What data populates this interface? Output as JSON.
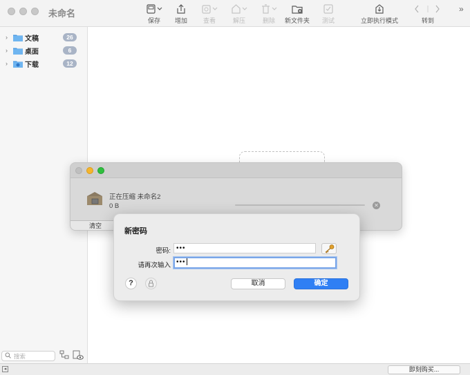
{
  "window": {
    "title": "未命名"
  },
  "toolbar": {
    "items": [
      {
        "label": "保存",
        "icon": "save-archive-icon",
        "enabled": true
      },
      {
        "label": "增加",
        "icon": "add-upload-icon",
        "enabled": true
      },
      {
        "label": "查看",
        "icon": "view-eye-icon",
        "enabled": false
      },
      {
        "label": "解压",
        "icon": "extract-icon",
        "enabled": false
      },
      {
        "label": "删除",
        "icon": "trash-icon",
        "enabled": false
      },
      {
        "label": "新文件夹",
        "icon": "new-folder-icon",
        "enabled": true
      },
      {
        "label": "测试",
        "icon": "test-check-icon",
        "enabled": false
      },
      {
        "label": "立即执行模式",
        "icon": "execute-now-icon",
        "enabled": true
      },
      {
        "label": "转到",
        "icon": "navigate-arrows-icon",
        "enabled": true
      }
    ]
  },
  "sidebar": {
    "items": [
      {
        "label": "文稿",
        "count": "26",
        "icon": "folder-icon"
      },
      {
        "label": "桌面",
        "count": "6",
        "icon": "folder-icon"
      },
      {
        "label": "下载",
        "count": "12",
        "icon": "download-folder-icon"
      }
    ],
    "search_placeholder": "搜索"
  },
  "status": {
    "buy_label": "即刻购买..."
  },
  "progress": {
    "name": "正在压缩 未命名2",
    "size": "0 B",
    "fraction": 0.0,
    "clear_label": "清空"
  },
  "password_dialog": {
    "title": "新密码",
    "password_label": "密码:",
    "password_value": "•••",
    "repeat_label": "请再次输入",
    "repeat_value": "•••",
    "cancel_label": "取消",
    "ok_label": "确定",
    "help_label": "?"
  },
  "colors": {
    "accent": "#2f7ff4",
    "badge": "#a9b4c6",
    "folder": "#5aa6e6"
  }
}
